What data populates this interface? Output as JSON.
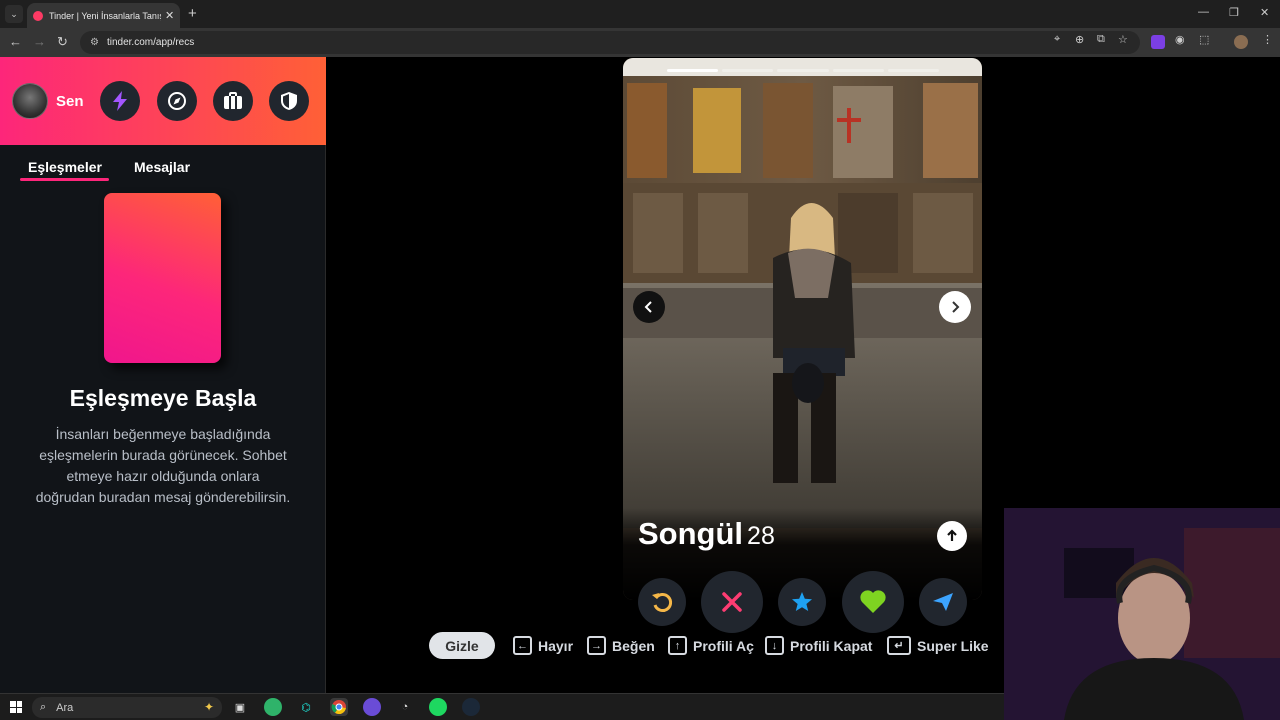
{
  "browser": {
    "tab_title": "Tinder | Yeni İnsanlarla Tanış, Bu",
    "url": "tinder.com/app/recs"
  },
  "sidebar": {
    "user_name": "Sen",
    "tabs": [
      "Eşleşmeler",
      "Mesajlar"
    ],
    "empty_title": "Eşleşmeye Başla",
    "empty_text": "İnsanları beğenmeye başladığında eşleşmelerin burada görünecek. Sohbet etmeye hazır olduğunda onlara doğrudan buradan mesaj gönderebilirsin."
  },
  "profile": {
    "name": "Songül",
    "age": "28",
    "photo_count": 5,
    "active_photo": 1
  },
  "shortcuts": {
    "hide_label": "Gizle",
    "items": [
      {
        "key": "←",
        "label": "Hayır"
      },
      {
        "key": "→",
        "label": "Beğen"
      },
      {
        "key": "↑",
        "label": "Profili Aç"
      },
      {
        "key": "↓",
        "label": "Profili Kapat"
      },
      {
        "key": "↵",
        "label": "Super Like"
      }
    ]
  },
  "taskbar": {
    "search_placeholder": "Ara"
  },
  "colors": {
    "brand_start": "#fd267a",
    "brand_end": "#ff6036",
    "rewind": "#f5b748",
    "nope": "#fe3c72",
    "superlike": "#1ea1f1",
    "like": "#7ed321",
    "boost": "#3ca4ff"
  }
}
